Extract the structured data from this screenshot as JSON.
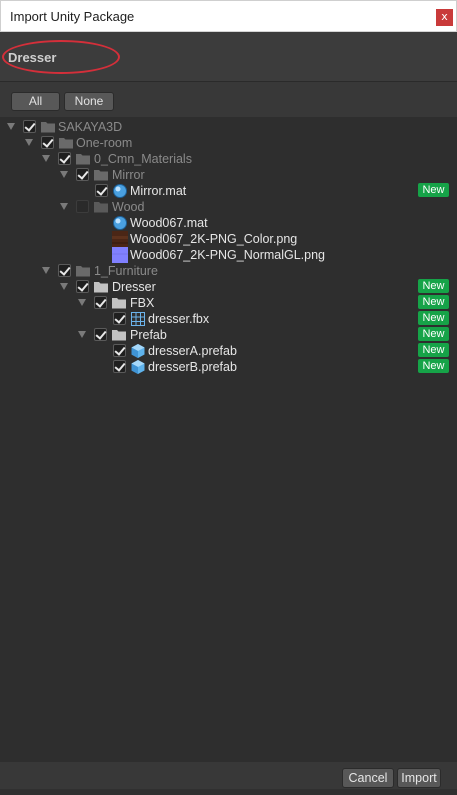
{
  "window": {
    "title": "Import Unity Package",
    "close_label": "x"
  },
  "header": {
    "package_name": "Dresser"
  },
  "toolbar": {
    "all_label": "All",
    "none_label": "None"
  },
  "tree": {
    "items": [
      {
        "label": "SAKAYA3D",
        "checked": true,
        "expanded": true,
        "kind": "folder",
        "dim": true,
        "new": false
      },
      {
        "label": "One-room",
        "checked": true,
        "expanded": true,
        "kind": "folder",
        "dim": true,
        "new": false
      },
      {
        "label": "0_Cmn_Materials",
        "checked": true,
        "expanded": true,
        "kind": "folder",
        "dim": true,
        "new": false
      },
      {
        "label": "Mirror",
        "checked": true,
        "expanded": true,
        "kind": "folder",
        "dim": true,
        "new": false
      },
      {
        "label": "Mirror.mat",
        "checked": true,
        "expanded": null,
        "kind": "material",
        "dim": false,
        "new": true
      },
      {
        "label": "Wood",
        "checked": false,
        "expanded": true,
        "kind": "folder",
        "dim": true,
        "new": false
      },
      {
        "label": "Wood067.mat",
        "checked": null,
        "expanded": null,
        "kind": "material",
        "dim": false,
        "new": false
      },
      {
        "label": "Wood067_2K-PNG_Color.png",
        "checked": null,
        "expanded": null,
        "kind": "texture-color",
        "dim": false,
        "new": false
      },
      {
        "label": "Wood067_2K-PNG_NormalGL.png",
        "checked": null,
        "expanded": null,
        "kind": "texture-normal",
        "dim": false,
        "new": false
      },
      {
        "label": "1_Furniture",
        "checked": true,
        "expanded": true,
        "kind": "folder",
        "dim": true,
        "new": false
      },
      {
        "label": "Dresser",
        "checked": true,
        "expanded": true,
        "kind": "folder",
        "dim": false,
        "new": true
      },
      {
        "label": "FBX",
        "checked": true,
        "expanded": true,
        "kind": "folder",
        "dim": false,
        "new": true
      },
      {
        "label": "dresser.fbx",
        "checked": true,
        "expanded": null,
        "kind": "model",
        "dim": false,
        "new": true
      },
      {
        "label": "Prefab",
        "checked": true,
        "expanded": true,
        "kind": "folder",
        "dim": false,
        "new": true
      },
      {
        "label": "dresserA.prefab",
        "checked": true,
        "expanded": null,
        "kind": "prefab",
        "dim": false,
        "new": true
      },
      {
        "label": "dresserB.prefab",
        "checked": true,
        "expanded": null,
        "kind": "prefab",
        "dim": false,
        "new": true
      }
    ],
    "new_badge_label": "New"
  },
  "footer": {
    "cancel_label": "Cancel",
    "import_label": "Import"
  },
  "colors": {
    "badge": "#16a348",
    "highlight": "#d42f3a",
    "close": "#c93a3a"
  }
}
